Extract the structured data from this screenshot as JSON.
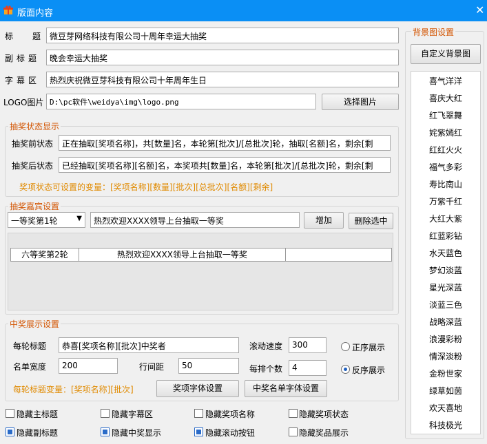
{
  "window": {
    "title": "版面内容",
    "close_glyph": "✕",
    "accent": "#0a8ff5"
  },
  "fields": {
    "title_label": "标　题",
    "title_value": "微豆芽网络科技有限公司十周年幸运大抽奖",
    "subtitle_label": "副标题",
    "subtitle_value": "晚会幸运大抽奖",
    "caption_label": "字幕区",
    "caption_value": "热烈庆祝微豆芽科技有限公司十年周年生日",
    "logo_label": "LOGO图片",
    "logo_value": "D:\\pc软件\\weidya\\img\\logo.png",
    "logo_button": "选择图片"
  },
  "status_group": {
    "title": "抽奖状态显示",
    "before_label": "抽奖前状态",
    "before_value": "正在抽取[奖项名称]，共[数量]名，本轮第[批次]/[总批次]轮，抽取[名额]名，剩余[剩",
    "after_label": "抽奖后状态",
    "after_value": "已经抽取[奖项名称][名额]名，本奖项共[数量]名，本轮第[批次]/[总批次]轮，剩余[剩",
    "vars_hint": "奖项状态可设置的变量：[奖项名称][数量][批次][总批次][名额][剩余]"
  },
  "guest_group": {
    "title": "抽奖嘉宾设置",
    "round_select": "一等奖第1轮",
    "guest_text": "热烈欢迎XXXX领导上台抽取一等奖",
    "add_button": "增加",
    "delete_button": "删除选中",
    "table_rows": [
      {
        "round": "六等奖第2轮",
        "text": "热烈欢迎XXXX领导上台抽取一等奖"
      }
    ]
  },
  "winner_group": {
    "title": "中奖展示设置",
    "round_title_label": "每轮标题",
    "round_title_value": "恭喜[奖项名称][批次]中奖者",
    "scroll_speed_label": "滚动速度",
    "scroll_speed_value": "300",
    "list_width_label": "名单宽度",
    "list_width_value": "200",
    "line_spacing_label": "行间距",
    "line_spacing_value": "50",
    "per_row_label": "每排个数",
    "per_row_value": "4",
    "order_asc": "正序展示",
    "order_desc": "反序展示",
    "title_vars_hint": "每轮标题变量：[奖项名称][批次]",
    "award_font_button": "奖项字体设置",
    "winner_font_button": "中奖名单字体设置"
  },
  "checkboxes": {
    "hide_main_title": "隐藏主标题",
    "hide_caption": "隐藏字幕区",
    "hide_award_name": "隐藏奖项名称",
    "hide_award_status": "隐藏奖项状态",
    "hide_subtitle": "隐藏副标题",
    "hide_winner_display": "隐藏中奖显示",
    "hide_scroll_button": "隐藏滚动按钮",
    "hide_prize_display": "隐藏奖品展示"
  },
  "background_group": {
    "title": "背景图设置",
    "custom_button": "自定义背景图",
    "items": [
      "喜气洋洋",
      "喜庆大红",
      "红飞翠舞",
      "姹紫嫣红",
      "红红火火",
      "福气多彩",
      "寿比南山",
      "万紫千红",
      "大红大紫",
      "红蓝彩钻",
      "水天蓝色",
      "梦幻淡蓝",
      "星光深蓝",
      "淡蓝三色",
      "战略深蓝",
      "浪漫彩粉",
      "情深淡粉",
      "金粉世家",
      "绿草如茵",
      "欢天喜地",
      "科技极光"
    ]
  }
}
